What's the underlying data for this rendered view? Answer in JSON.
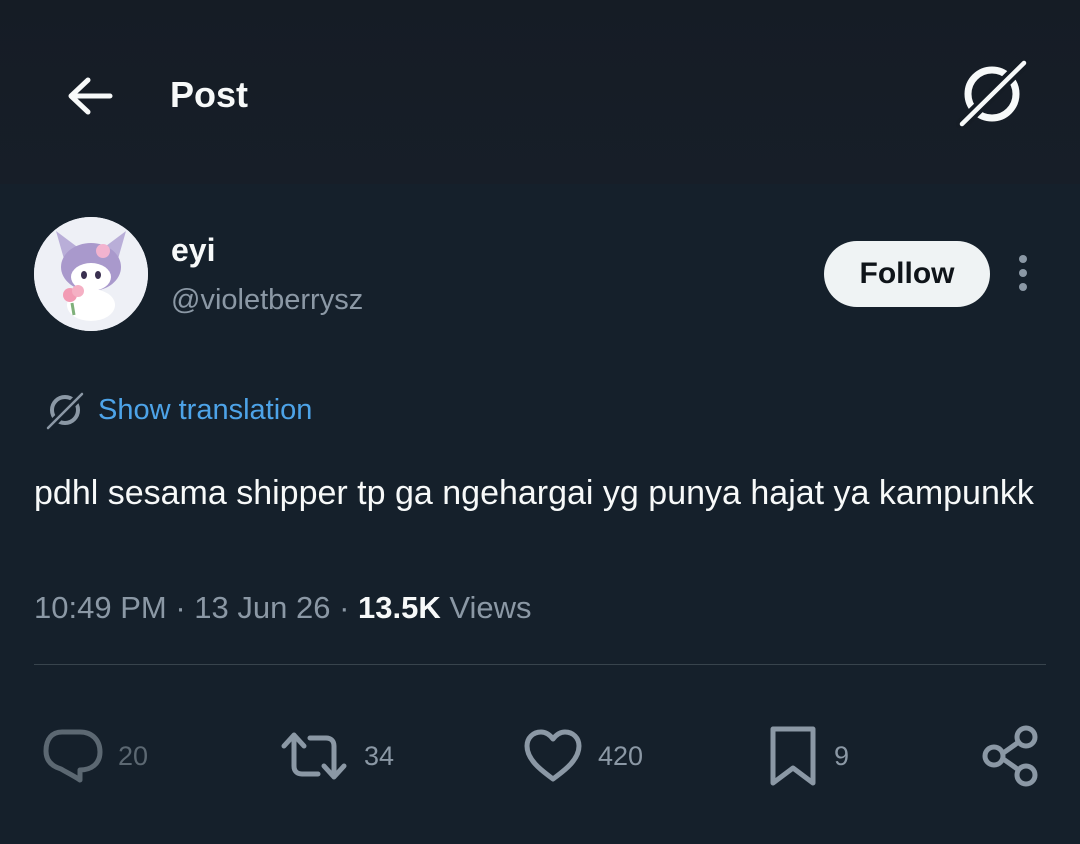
{
  "header": {
    "title": "Post",
    "back_icon": "arrow-left-icon",
    "grok_icon": "grok-icon"
  },
  "author": {
    "display_name": "eyi",
    "handle": "@violetberrysz",
    "follow_label": "Follow"
  },
  "post": {
    "translate_label": "Show translation",
    "text": "pdhl sesama shipper tp ga ngehargai yg punya hajat ya kampunkk",
    "time": "10:49 PM",
    "date": "13 Jun 26",
    "views_count": "13.5K",
    "views_label": "Views"
  },
  "actions": {
    "replies": "20",
    "reposts": "34",
    "likes": "420",
    "bookmarks": "9"
  },
  "colors": {
    "background": "#15202b",
    "text": "#f7f9f9",
    "muted": "#8b98a5",
    "link": "#4da3e8",
    "divider": "#38444d"
  }
}
